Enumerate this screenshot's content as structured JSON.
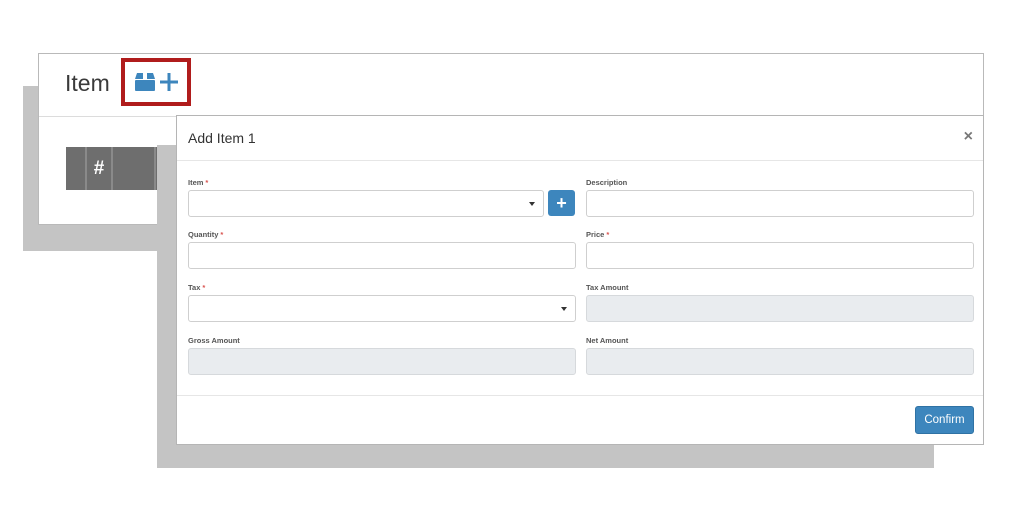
{
  "background": {
    "title": "Item",
    "table_headers": [
      "",
      "#",
      "",
      ""
    ]
  },
  "modal": {
    "title": "Add Item 1",
    "close_glyph": "×",
    "fields": {
      "item": {
        "label": "Item",
        "required": "*",
        "value": ""
      },
      "description": {
        "label": "Description",
        "value": ""
      },
      "quantity": {
        "label": "Quantity",
        "required": "*",
        "value": ""
      },
      "price": {
        "label": "Price",
        "required": "*",
        "value": ""
      },
      "tax": {
        "label": "Tax",
        "required": "*",
        "value": ""
      },
      "tax_amount": {
        "label": "Tax Amount",
        "value": ""
      },
      "gross_amount": {
        "label": "Gross Amount",
        "value": ""
      },
      "net_amount": {
        "label": "Net Amount",
        "value": ""
      }
    },
    "add_item_glyph": "+",
    "confirm_label": "Confirm"
  },
  "colors": {
    "primary": "#3d86bd",
    "highlight_border": "#b01c1c",
    "required": "#d9534f",
    "readonly_bg": "#e9ecef"
  },
  "icons": [
    "box-icon",
    "plus-icon",
    "close-icon",
    "caret-down-icon"
  ]
}
